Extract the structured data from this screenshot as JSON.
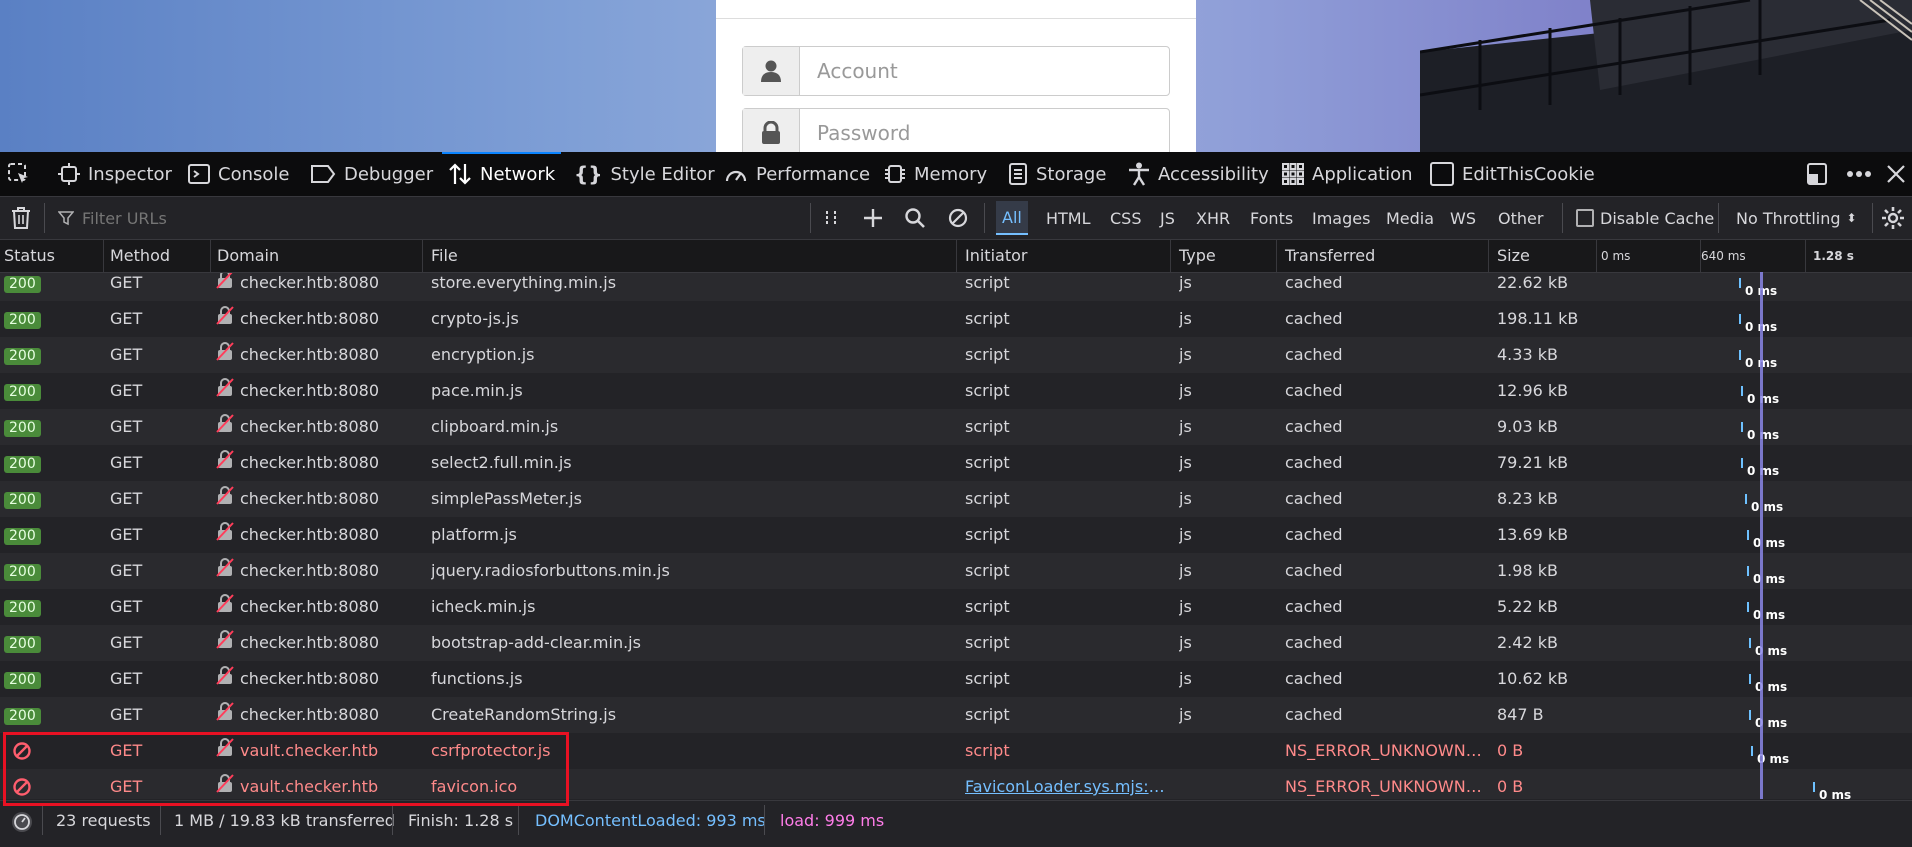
{
  "login": {
    "account_placeholder": "Account",
    "password_placeholder": "Password"
  },
  "devtools": {
    "tabs": [
      {
        "label": "Inspector",
        "icon": "inspector-icon"
      },
      {
        "label": "Console",
        "icon": "console-icon"
      },
      {
        "label": "Debugger",
        "icon": "debugger-icon"
      },
      {
        "label": "Network",
        "icon": "network-icon",
        "selected": true
      },
      {
        "label": "Style Editor",
        "icon": "style-editor-icon"
      },
      {
        "label": "Performance",
        "icon": "performance-icon"
      },
      {
        "label": "Memory",
        "icon": "memory-icon"
      },
      {
        "label": "Storage",
        "icon": "storage-icon"
      },
      {
        "label": "Accessibility",
        "icon": "accessibility-icon"
      },
      {
        "label": "Application",
        "icon": "application-icon"
      },
      {
        "label": "EditThisCookie",
        "icon": "checkbox-icon"
      }
    ],
    "toolbar": {
      "filter_placeholder": "Filter URLs",
      "filters": [
        "All",
        "HTML",
        "CSS",
        "JS",
        "XHR",
        "Fonts",
        "Images",
        "Media",
        "WS",
        "Other"
      ],
      "selected_filter": "All",
      "disable_cache_label": "Disable Cache",
      "throttling_label": "No Throttling"
    },
    "columns": [
      "Status",
      "Method",
      "Domain",
      "File",
      "Initiator",
      "Type",
      "Transferred",
      "Size"
    ],
    "waterfall_ticks": [
      "0 ms",
      "640 ms",
      "1.28 s"
    ],
    "rows": [
      {
        "status": "200",
        "method": "GET",
        "domain": "checker.htb:8080",
        "file": "store.everything.min.js",
        "initiator": "script",
        "type": "js",
        "transferred": "cached",
        "size": "22.62 kB",
        "timing": "0 ms"
      },
      {
        "status": "200",
        "method": "GET",
        "domain": "checker.htb:8080",
        "file": "crypto-js.js",
        "initiator": "script",
        "type": "js",
        "transferred": "cached",
        "size": "198.11 kB",
        "timing": "0 ms"
      },
      {
        "status": "200",
        "method": "GET",
        "domain": "checker.htb:8080",
        "file": "encryption.js",
        "initiator": "script",
        "type": "js",
        "transferred": "cached",
        "size": "4.33 kB",
        "timing": "0 ms"
      },
      {
        "status": "200",
        "method": "GET",
        "domain": "checker.htb:8080",
        "file": "pace.min.js",
        "initiator": "script",
        "type": "js",
        "transferred": "cached",
        "size": "12.96 kB",
        "timing": "0 ms"
      },
      {
        "status": "200",
        "method": "GET",
        "domain": "checker.htb:8080",
        "file": "clipboard.min.js",
        "initiator": "script",
        "type": "js",
        "transferred": "cached",
        "size": "9.03 kB",
        "timing": "0 ms"
      },
      {
        "status": "200",
        "method": "GET",
        "domain": "checker.htb:8080",
        "file": "select2.full.min.js",
        "initiator": "script",
        "type": "js",
        "transferred": "cached",
        "size": "79.21 kB",
        "timing": "0 ms"
      },
      {
        "status": "200",
        "method": "GET",
        "domain": "checker.htb:8080",
        "file": "simplePassMeter.js",
        "initiator": "script",
        "type": "js",
        "transferred": "cached",
        "size": "8.23 kB",
        "timing": "0 ms"
      },
      {
        "status": "200",
        "method": "GET",
        "domain": "checker.htb:8080",
        "file": "platform.js",
        "initiator": "script",
        "type": "js",
        "transferred": "cached",
        "size": "13.69 kB",
        "timing": "0 ms"
      },
      {
        "status": "200",
        "method": "GET",
        "domain": "checker.htb:8080",
        "file": "jquery.radiosforbuttons.min.js",
        "initiator": "script",
        "type": "js",
        "transferred": "cached",
        "size": "1.98 kB",
        "timing": "0 ms"
      },
      {
        "status": "200",
        "method": "GET",
        "domain": "checker.htb:8080",
        "file": "icheck.min.js",
        "initiator": "script",
        "type": "js",
        "transferred": "cached",
        "size": "5.22 kB",
        "timing": "0 ms"
      },
      {
        "status": "200",
        "method": "GET",
        "domain": "checker.htb:8080",
        "file": "bootstrap-add-clear.min.js",
        "initiator": "script",
        "type": "js",
        "transferred": "cached",
        "size": "2.42 kB",
        "timing": "0 ms"
      },
      {
        "status": "200",
        "method": "GET",
        "domain": "checker.htb:8080",
        "file": "functions.js",
        "initiator": "script",
        "type": "js",
        "transferred": "cached",
        "size": "10.62 kB",
        "timing": "0 ms"
      },
      {
        "status": "200",
        "method": "GET",
        "domain": "checker.htb:8080",
        "file": "CreateRandomString.js",
        "initiator": "script",
        "type": "js",
        "transferred": "cached",
        "size": "847 B",
        "timing": "0 ms"
      },
      {
        "status": "blocked",
        "method": "GET",
        "domain": "vault.checker.htb",
        "file": "csrfprotector.js",
        "initiator": "script",
        "type": "",
        "transferred": "NS_ERROR_UNKNOWN…",
        "size": "0 B",
        "timing": "0 ms"
      },
      {
        "status": "blocked",
        "method": "GET",
        "domain": "vault.checker.htb",
        "file": "favicon.ico",
        "initiator": "FaviconLoader.sys.mjs:1…",
        "type": "",
        "transferred": "NS_ERROR_UNKNOWN…",
        "size": "0 B",
        "timing": "0 ms"
      }
    ],
    "statusbar": {
      "requests": "23 requests",
      "transferred": "1 MB / 19.83 kB transferred",
      "finish": "Finish: 1.28 s",
      "dom_content_loaded": "DOMContentLoaded: 993 ms",
      "load": "load: 999 ms"
    }
  },
  "colors": {
    "accent": "#0a84ff",
    "status_ok": "#4a8b3a",
    "error": "#ff8a8a",
    "highlight": "#e81123",
    "dcl": "#75bfff",
    "load": "#ff7de9"
  }
}
